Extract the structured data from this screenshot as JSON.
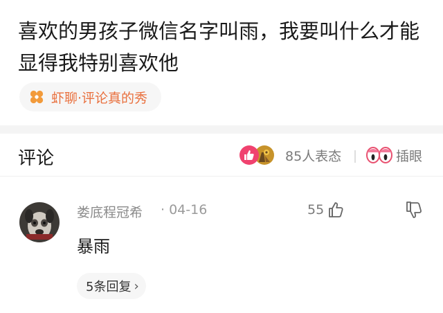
{
  "question": {
    "title": "喜欢的男孩子微信名字叫雨，我要叫什么才能显得我特别喜欢他"
  },
  "topic": {
    "label": "虾聊·评论真的秀",
    "icon": "flower-icon",
    "accent_color": "#e9703e",
    "icon_color": "#f29a3a"
  },
  "comments_header": {
    "title": "评论",
    "reaction_count_text": "85人表态",
    "reaction_icons": [
      "thumbs-up-icon",
      "cheers-icon"
    ],
    "peek_label": "插眼",
    "peek_icon": "eyes-icon"
  },
  "comments": [
    {
      "author": "娄底程冠希",
      "date": "· 04-16",
      "likes": "55",
      "body": "暴雨",
      "replies_label": "5条回复",
      "avatar": "dog-avatar"
    }
  ]
}
